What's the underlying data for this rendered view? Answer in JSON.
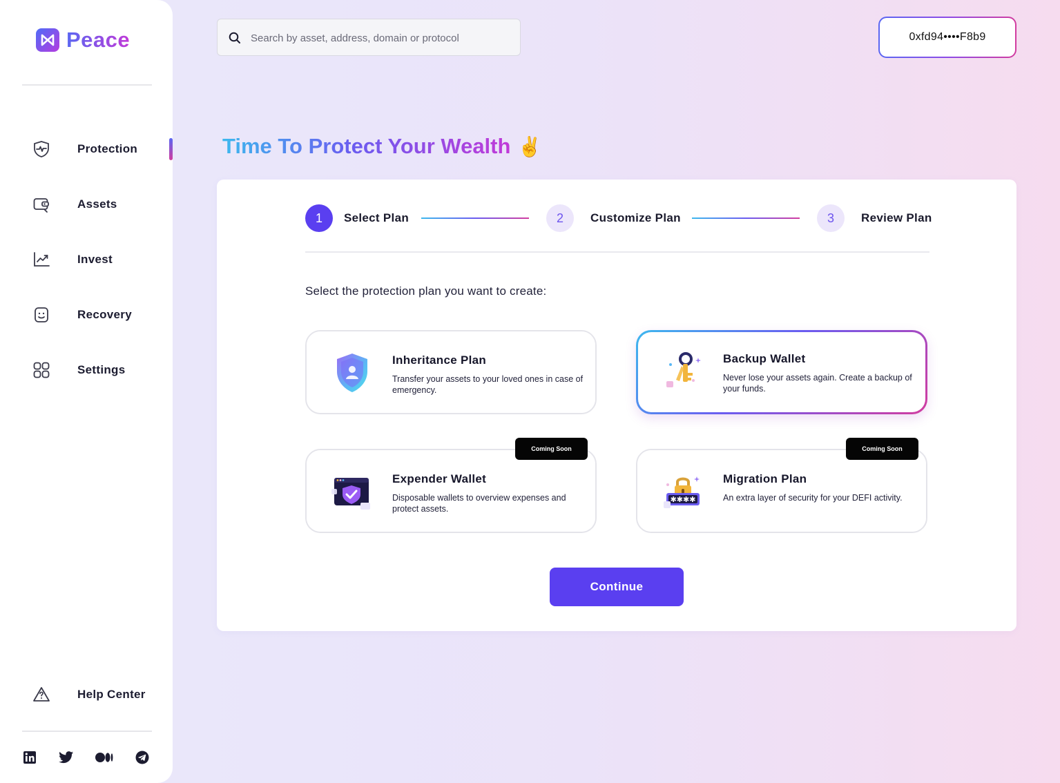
{
  "brand": {
    "name": "Peace"
  },
  "sidebar": {
    "items": [
      {
        "label": "Protection",
        "icon": "shield-pulse-icon",
        "active": true
      },
      {
        "label": "Assets",
        "icon": "wallet-icon",
        "active": false
      },
      {
        "label": "Invest",
        "icon": "trend-chart-icon",
        "active": false
      },
      {
        "label": "Recovery",
        "icon": "smile-face-icon",
        "active": false
      },
      {
        "label": "Settings",
        "icon": "grid-icon",
        "active": false
      }
    ],
    "help": {
      "label": "Help Center",
      "icon": "warning-question-icon"
    },
    "socials": [
      "linkedin-icon",
      "twitter-icon",
      "medium-icon",
      "telegram-icon"
    ]
  },
  "search": {
    "placeholder": "Search by asset, address, domain or protocol",
    "value": ""
  },
  "wallet": {
    "address": "0xfd94••••F8b9"
  },
  "headline": {
    "text": "Time To Protect Your Wealth",
    "emoji": "✌️"
  },
  "stepper": {
    "steps": [
      {
        "number": "1",
        "label": "Select Plan",
        "active": true
      },
      {
        "number": "2",
        "label": "Customize Plan",
        "active": false
      },
      {
        "number": "3",
        "label": "Review Plan",
        "active": false
      }
    ]
  },
  "prompt": "Select the protection plan you want to create:",
  "plans": [
    {
      "title": "Inheritance Plan",
      "description": "Transfer your assets to your loved ones in case of emergency.",
      "icon": "shield-person-icon",
      "selected": false,
      "badge": ""
    },
    {
      "title": "Backup Wallet",
      "description": "Never lose your assets again. Create a backup of your funds.",
      "icon": "key-icon",
      "selected": true,
      "badge": ""
    },
    {
      "title": "Expender Wallet",
      "description": "Disposable wallets to overview expenses and protect assets.",
      "icon": "browser-shield-icon",
      "selected": false,
      "badge": "Coming Soon"
    },
    {
      "title": "Migration Plan",
      "description": "An extra layer of security for your DEFI activity.",
      "icon": "lock-password-icon",
      "selected": false,
      "badge": "Coming Soon"
    }
  ],
  "actions": {
    "continue_label": "Continue"
  },
  "colors": {
    "accent": "#5a3ff0",
    "gradient_start": "#3db8ee",
    "gradient_mid": "#6a5cf0",
    "gradient_end": "#d23c9f"
  }
}
